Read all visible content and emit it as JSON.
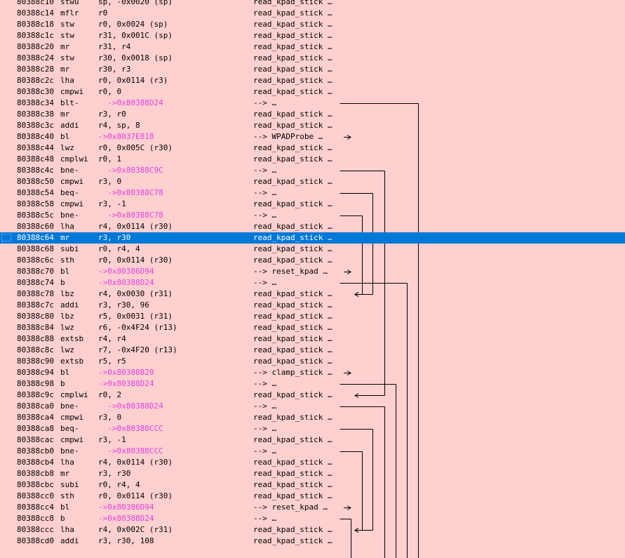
{
  "rows": [
    {
      "address": "80388c10",
      "mnemonic": "stwu",
      "operands": "sp, -0x0020 (sp)",
      "comment": "read_kpad_stick …"
    },
    {
      "address": "80388c14",
      "mnemonic": "mflr",
      "operands": "r0",
      "comment": "read_kpad_stick …"
    },
    {
      "address": "80388c18",
      "mnemonic": "stw",
      "operands": "r0, 0x0024 (sp)",
      "comment": "read_kpad_stick …"
    },
    {
      "address": "80388c1c",
      "mnemonic": "stw",
      "operands": "r31, 0x001C (sp)",
      "comment": "read_kpad_stick …"
    },
    {
      "address": "80388c20",
      "mnemonic": "mr",
      "operands": "r31, r4",
      "comment": "read_kpad_stick …"
    },
    {
      "address": "80388c24",
      "mnemonic": "stw",
      "operands": "r30, 0x0018 (sp)",
      "comment": "read_kpad_stick …"
    },
    {
      "address": "80388c28",
      "mnemonic": "mr",
      "operands": "r30, r3",
      "comment": "read_kpad_stick …"
    },
    {
      "address": "80388c2c",
      "mnemonic": "lha",
      "operands": "r0, 0x0114 (r3)",
      "comment": "read_kpad_stick …"
    },
    {
      "address": "80388c30",
      "mnemonic": "cmpwi",
      "operands": "r0, 0",
      "comment": "read_kpad_stick …"
    },
    {
      "address": "80388c34",
      "mnemonic": "blt-",
      "operands": "  ->0x80388D24",
      "comment": "--> …",
      "branch": true
    },
    {
      "address": "80388c38",
      "mnemonic": "mr",
      "operands": "r3, r0",
      "comment": "read_kpad_stick …"
    },
    {
      "address": "80388c3c",
      "mnemonic": "addi",
      "operands": "r4, sp, 8",
      "comment": "read_kpad_stick …"
    },
    {
      "address": "80388c40",
      "mnemonic": "bl",
      "operands": "->0x8037E018",
      "comment": "--> WPADProbe …",
      "branch": true
    },
    {
      "address": "80388c44",
      "mnemonic": "lwz",
      "operands": "r0, 0x005C (r30)",
      "comment": "read_kpad_stick …"
    },
    {
      "address": "80388c48",
      "mnemonic": "cmplwi",
      "operands": "r0, 1",
      "comment": "read_kpad_stick …"
    },
    {
      "address": "80388c4c",
      "mnemonic": "bne-",
      "operands": "  ->0x80388C9C",
      "comment": "--> …",
      "branch": true
    },
    {
      "address": "80388c50",
      "mnemonic": "cmpwi",
      "operands": "r3, 0",
      "comment": "read_kpad_stick …"
    },
    {
      "address": "80388c54",
      "mnemonic": "beq-",
      "operands": "  ->0x80388C78",
      "comment": "--> …",
      "branch": true
    },
    {
      "address": "80388c58",
      "mnemonic": "cmpwi",
      "operands": "r3, -1",
      "comment": "read_kpad_stick …"
    },
    {
      "address": "80388c5c",
      "mnemonic": "bne-",
      "operands": "  ->0x80388C78",
      "comment": "--> …",
      "branch": true
    },
    {
      "address": "80388c60",
      "mnemonic": "lha",
      "operands": "r4, 0x0114 (r30)",
      "comment": "read_kpad_stick …"
    },
    {
      "address": "80388c64",
      "mnemonic": "mr",
      "operands": "r3, r30",
      "comment": "read_kpad_stick …",
      "selected": true
    },
    {
      "address": "80388c68",
      "mnemonic": "subi",
      "operands": "r0, r4, 4",
      "comment": "read_kpad_stick …"
    },
    {
      "address": "80388c6c",
      "mnemonic": "sth",
      "operands": "r0, 0x0114 (r30)",
      "comment": "read_kpad_stick …"
    },
    {
      "address": "80388c70",
      "mnemonic": "bl",
      "operands": "->0x80386D94",
      "comment": "--> reset_kpad …",
      "branch": true
    },
    {
      "address": "80388c74",
      "mnemonic": "b",
      "operands": "->0x80388D24",
      "comment": "--> …",
      "branch": true
    },
    {
      "address": "80388c78",
      "mnemonic": "lbz",
      "operands": "r4, 0x0030 (r31)",
      "comment": "read_kpad_stick …"
    },
    {
      "address": "80388c7c",
      "mnemonic": "addi",
      "operands": "r3, r30, 96",
      "comment": "read_kpad_stick …"
    },
    {
      "address": "80388c80",
      "mnemonic": "lbz",
      "operands": "r5, 0x0031 (r31)",
      "comment": "read_kpad_stick …"
    },
    {
      "address": "80388c84",
      "mnemonic": "lwz",
      "operands": "r6, -0x4F24 (r13)",
      "comment": "read_kpad_stick …"
    },
    {
      "address": "80388c88",
      "mnemonic": "extsb",
      "operands": "r4, r4",
      "comment": "read_kpad_stick …"
    },
    {
      "address": "80388c8c",
      "mnemonic": "lwz",
      "operands": "r7, -0x4F20 (r13)",
      "comment": "read_kpad_stick …"
    },
    {
      "address": "80388c90",
      "mnemonic": "extsb",
      "operands": "r5, r5",
      "comment": "read_kpad_stick …"
    },
    {
      "address": "80388c94",
      "mnemonic": "bl",
      "operands": "->0x80388B20",
      "comment": "--> clamp_stick …",
      "branch": true
    },
    {
      "address": "80388c98",
      "mnemonic": "b",
      "operands": "->0x80388D24",
      "comment": "--> …",
      "branch": true
    },
    {
      "address": "80388c9c",
      "mnemonic": "cmplwi",
      "operands": "r0, 2",
      "comment": "read_kpad_stick …"
    },
    {
      "address": "80388ca0",
      "mnemonic": "bne-",
      "operands": "  ->0x80388D24",
      "comment": "--> …",
      "branch": true
    },
    {
      "address": "80388ca4",
      "mnemonic": "cmpwi",
      "operands": "r3, 0",
      "comment": "read_kpad_stick …"
    },
    {
      "address": "80388ca8",
      "mnemonic": "beq-",
      "operands": "  ->0x80388CCC",
      "comment": "--> …",
      "branch": true
    },
    {
      "address": "80388cac",
      "mnemonic": "cmpwi",
      "operands": "r3, -1",
      "comment": "read_kpad_stick …"
    },
    {
      "address": "80388cb0",
      "mnemonic": "bne-",
      "operands": "  ->0x80388CCC",
      "comment": "--> …",
      "branch": true
    },
    {
      "address": "80388cb4",
      "mnemonic": "lha",
      "operands": "r4, 0x0114 (r30)",
      "comment": "read_kpad_stick …"
    },
    {
      "address": "80388cb8",
      "mnemonic": "mr",
      "operands": "r3, r30",
      "comment": "read_kpad_stick …"
    },
    {
      "address": "80388cbc",
      "mnemonic": "subi",
      "operands": "r0, r4, 4",
      "comment": "read_kpad_stick …"
    },
    {
      "address": "80388cc0",
      "mnemonic": "sth",
      "operands": "r0, 0x0114 (r30)",
      "comment": "read_kpad_stick …"
    },
    {
      "address": "80388cc4",
      "mnemonic": "bl",
      "operands": "->0x80386D94",
      "comment": "--> reset_kpad …",
      "branch": true
    },
    {
      "address": "80388cc8",
      "mnemonic": "b",
      "operands": "->0x80388D24",
      "comment": "--> …",
      "branch": true
    },
    {
      "address": "80388ccc",
      "mnemonic": "lha",
      "operands": "r4, 0x002C (r31)",
      "comment": "read_kpad_stick …"
    },
    {
      "address": "80388cd0",
      "mnemonic": "addi",
      "operands": "r3, r30, 108",
      "comment": "read_kpad_stick …"
    }
  ],
  "colors": {
    "background": "#ffd0d0",
    "selection": "#0078d7",
    "branch_target": "#e040e0"
  }
}
